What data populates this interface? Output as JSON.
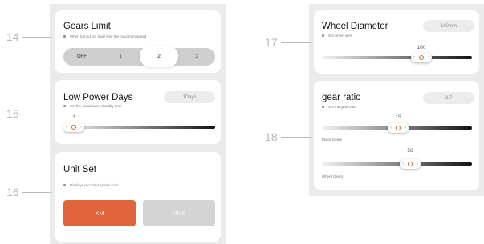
{
  "callouts": {
    "c14": "14",
    "c15": "15",
    "c16": "16",
    "c17": "17",
    "c18": "18"
  },
  "gears_limit": {
    "title": "Gears Limit",
    "description": "When turned on, it will limit the maximum speed",
    "options": [
      "OFF",
      "1",
      "2",
      "3"
    ],
    "selected": "2"
  },
  "low_power_days": {
    "title": "Low Power Days",
    "value_badge": "1Days",
    "description": "Set the skateboard standby time",
    "slider_value": "1"
  },
  "unit_set": {
    "title": "Unit Set",
    "description": "Displays recorded speed units",
    "km_label": "KM",
    "mile_label": "MILE",
    "selected": "KM",
    "accent_color": "#e0653a"
  },
  "wheel_diameter": {
    "title": "Wheel Diameter",
    "value_badge": "160mm",
    "description": "Set wheel size",
    "slider_value": "160"
  },
  "gear_ratio": {
    "title": "gear ratio",
    "value_badge": "3.7",
    "description": "Set the gear ratio",
    "motor_value": "15",
    "motor_label": "Motor Gears",
    "wheel_value": "56",
    "wheel_label": "Wheel Gears"
  },
  "icons": {
    "slider_knob": "chevron-ring-chevron-icon"
  }
}
